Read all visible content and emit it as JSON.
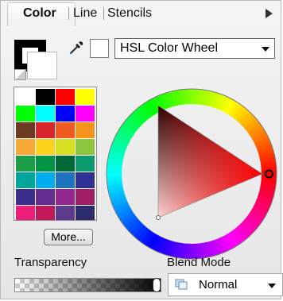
{
  "tabs": [
    {
      "label": "Color",
      "active": true
    },
    {
      "label": "Line",
      "active": false
    },
    {
      "label": "Stencils",
      "active": false
    }
  ],
  "color_mode": {
    "selected": "HSL Color Wheel"
  },
  "palette": {
    "colors": [
      "#ffffff",
      "#000000",
      "#ff0000",
      "#ffff00",
      "#00ff00",
      "#00ffff",
      "#0000ff",
      "#ff00ff",
      "#6b3a22",
      "#d9262b",
      "#f05a24",
      "#f7941d",
      "#f7a938",
      "#ffd21c",
      "#d7df23",
      "#8dc63f",
      "#1c9d4a",
      "#009444",
      "#006838",
      "#0a9a6d",
      "#00a69c",
      "#00aeef",
      "#1e73be",
      "#2e3192",
      "#3a2f8f",
      "#662d91",
      "#92278f",
      "#9e1f63",
      "#ed1e79",
      "#c2185b",
      "#5e3a8c",
      "#2b2b6e"
    ],
    "more_label": "More..."
  },
  "transparency": {
    "label": "Transparency",
    "value": 0.97
  },
  "blend_mode": {
    "label": "Blend Mode",
    "selected": "Normal"
  },
  "wheel": {
    "hue_selected_deg": 0
  }
}
